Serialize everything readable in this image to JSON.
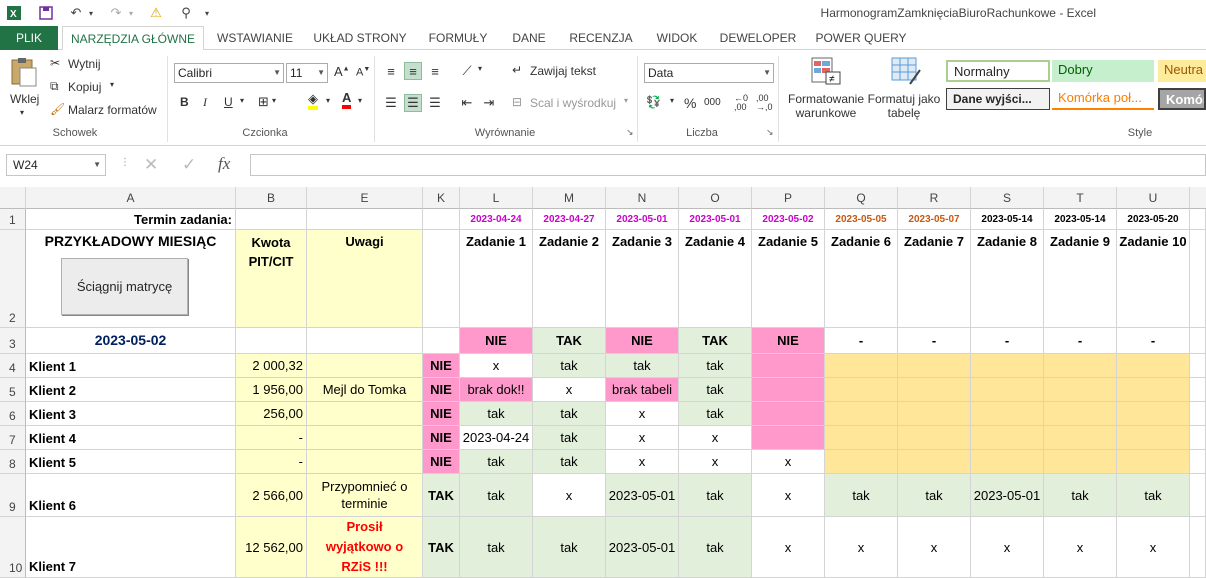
{
  "window": {
    "title": "HarmonogramZamknięciaBiuroRachunkowe - Excel"
  },
  "tabs": [
    "PLIK",
    "NARZĘDZIA GŁÓWNE",
    "WSTAWIANIE",
    "UKŁAD STRONY",
    "FORMUŁY",
    "DANE",
    "RECENZJA",
    "WIDOK",
    "DEWELOPER",
    "POWER QUERY"
  ],
  "ribbon": {
    "clipboard": {
      "paste": "Wklej",
      "cut": "Wytnij",
      "copy": "Kopiuj",
      "painter": "Malarz formatów",
      "label": "Schowek"
    },
    "font": {
      "name": "Calibri",
      "size": "11",
      "grow": "A",
      "shrink": "A",
      "bold": "B",
      "italic": "I",
      "underline": "U",
      "fill": "A",
      "color": "A",
      "label": "Czcionka"
    },
    "alignment": {
      "wrap": "Zawijaj tekst",
      "merge": "Scal i wyśrodkuj",
      "label": "Wyrównanie"
    },
    "number": {
      "format": "Data",
      "percent": "%",
      "thousands": "000",
      "label": "Liczba"
    },
    "styles": {
      "conditional": "Formatowanie warunkowe",
      "table": "Formatuj jako tabelę",
      "normal": "Normalny",
      "good": "Dobry",
      "neutral": "Neutra",
      "output": "Dane wyjści...",
      "linked": "Komórka poł...",
      "check": "Komór",
      "label": "Style"
    }
  },
  "formula_bar": {
    "name_box": "W24",
    "fx": "fx",
    "cancel": "✕",
    "enter": "✓"
  },
  "columns": [
    "A",
    "B",
    "E",
    "K",
    "L",
    "M",
    "N",
    "O",
    "P",
    "Q",
    "R",
    "S",
    "T",
    "U"
  ],
  "rows": [
    "1",
    "2",
    "3",
    "4",
    "5",
    "6",
    "7",
    "8",
    "9",
    "10"
  ],
  "sheet": {
    "a1": "Termin zadania:",
    "a2": "PRZYKŁADOWY MIESIĄC",
    "button": "Ściągnij matrycę",
    "b2": "Kwota PIT/CIT",
    "e2": "Uwagi",
    "a3": "2023-05-02",
    "deadlines": [
      "2023-04-24",
      "2023-04-27",
      "2023-05-01",
      "2023-05-01",
      "2023-05-02",
      "2023-05-05",
      "2023-05-07",
      "2023-05-14",
      "2023-05-14",
      "2023-05-20"
    ],
    "tasks": [
      "Zadanie 1",
      "Zadanie 2",
      "Zadanie 3",
      "Zadanie 4",
      "Zadanie 5",
      "Zadanie 6",
      "Zadanie 7",
      "Zadanie 8",
      "Zadanie 9",
      "Zadanie 10"
    ],
    "row3": [
      "NIE",
      "TAK",
      "NIE",
      "TAK",
      "NIE",
      "-",
      "-",
      "-",
      "-",
      "-"
    ],
    "clients": [
      {
        "name": "Klient 1",
        "amount": "2 000,32",
        "note": "",
        "k": "NIE",
        "cells": [
          "x",
          "tak",
          "tak",
          "tak",
          "",
          "",
          "",
          "",
          "",
          ""
        ]
      },
      {
        "name": "Klient 2",
        "amount": "1 956,00",
        "note": "Mejl do Tomka",
        "k": "NIE",
        "cells": [
          "brak dok!!",
          "x",
          "brak tabeli",
          "tak",
          "",
          "",
          "",
          "",
          "",
          ""
        ]
      },
      {
        "name": "Klient 3",
        "amount": "256,00",
        "note": "",
        "k": "NIE",
        "cells": [
          "tak",
          "tak",
          "x",
          "tak",
          "",
          "",
          "",
          "",
          "",
          ""
        ]
      },
      {
        "name": "Klient 4",
        "amount": "-",
        "note": "",
        "k": "NIE",
        "cells": [
          "2023-04-24",
          "tak",
          "x",
          "x",
          "",
          "",
          "",
          "",
          "",
          ""
        ]
      },
      {
        "name": "Klient 5",
        "amount": "-",
        "note": "",
        "k": "NIE",
        "cells": [
          "tak",
          "tak",
          "x",
          "x",
          "x",
          "",
          "",
          "",
          "",
          ""
        ]
      },
      {
        "name": "Klient 6",
        "amount": "2 566,00",
        "note": "Przypomnieć o terminie",
        "k": "TAK",
        "cells": [
          "tak",
          "x",
          "2023-05-01",
          "tak",
          "x",
          "tak",
          "tak",
          "2023-05-01",
          "tak",
          "tak"
        ]
      },
      {
        "name": "Klient 7",
        "amount": "12 562,00",
        "note": "Prosił wyjątkowo o RZiS !!!",
        "k": "TAK",
        "cells": [
          "tak",
          "tak",
          "2023-05-01",
          "tak",
          "x",
          "x",
          "x",
          "x",
          "x",
          "x"
        ]
      }
    ]
  },
  "colors": {
    "excel_green": "#217346",
    "pink": "#ff99cc",
    "green_fill": "#e2efda",
    "yellow_fill": "#ffffcc",
    "orange_fill": "#ffe699",
    "date_magenta": "#cc00cc",
    "date_orange": "#c65911",
    "blue_text": "#002060",
    "red_text": "#ff0000"
  }
}
